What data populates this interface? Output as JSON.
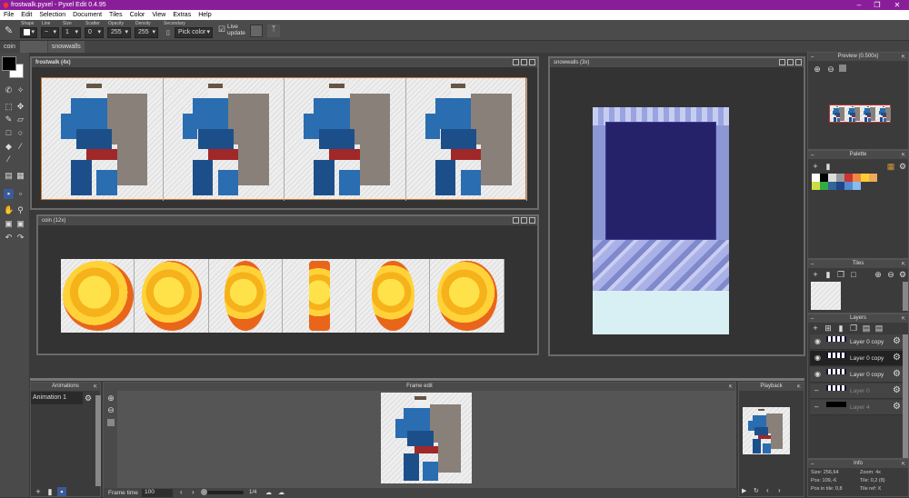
{
  "window": {
    "title": "frostwalk.pyxel - Pyxel Edit 0.4.95"
  },
  "menu": [
    "File",
    "Edit",
    "Selection",
    "Document",
    "Tiles",
    "Color",
    "View",
    "Extras",
    "Help"
  ],
  "toolbar": {
    "shape_label": "Shape",
    "line_label": "Line",
    "size_label": "Size",
    "size": "1",
    "scatter_label": "Scatter",
    "scatter": "0",
    "opacity_label": "Opacity",
    "opacity": "255",
    "density_label": "Density",
    "density": "255",
    "secondary_label": "Secondary",
    "secondary": "Pick color",
    "live_update": "Live update",
    "live_update_checked": true
  },
  "tabs": [
    "coin",
    "frostwalk",
    "snowwalls"
  ],
  "documents": {
    "frostwalk": "frostwalk  (4x)",
    "coin": "coin  (12x)",
    "snowwalls": "snowwalls  (3x)"
  },
  "panels": {
    "preview": "Preview (0.500x)",
    "palette": "Palette",
    "tiles": "Tiles",
    "layers": "Layers",
    "info": "Info",
    "animations": "Animations",
    "frame_edit": "Frame edit",
    "playback": "Playback"
  },
  "palette_colors": [
    "#ffffff",
    "#000000",
    "#dddddd",
    "#999999",
    "#cc3333",
    "#ee8844",
    "#ffcc33",
    "#eeaa55",
    "#ccdd44",
    "#33aa44",
    "#336699",
    "#224488",
    "#5588cc",
    "#88bbee"
  ],
  "layers": [
    {
      "name": "Layer 0 copy",
      "visible": true,
      "selected": false
    },
    {
      "name": "Layer 0 copy",
      "visible": true,
      "selected": true
    },
    {
      "name": "Layer 0 copy",
      "visible": true,
      "selected": false
    },
    {
      "name": "Layer 0",
      "visible": false,
      "selected": false
    },
    {
      "name": "Layer 4",
      "visible": false,
      "selected": false
    }
  ],
  "info": {
    "size": "Size: 256,64",
    "zoom": "Zoom: 4x",
    "pos": "Pos: 109,-6",
    "tile": "Tile: 0,2 (8)",
    "pos_in_tile": "Pos in tile: 0,8",
    "tile_ref": "Tile ref: X"
  },
  "animations": {
    "items": [
      "Animation 1"
    ]
  },
  "frame_controls": {
    "frame_time_label": "Frame time",
    "frame_time": "100",
    "frame_counter": "1/4"
  },
  "colors": {
    "title_bar": "#8a1e9a",
    "primary": "#000000",
    "secondary": "#ffffff"
  }
}
